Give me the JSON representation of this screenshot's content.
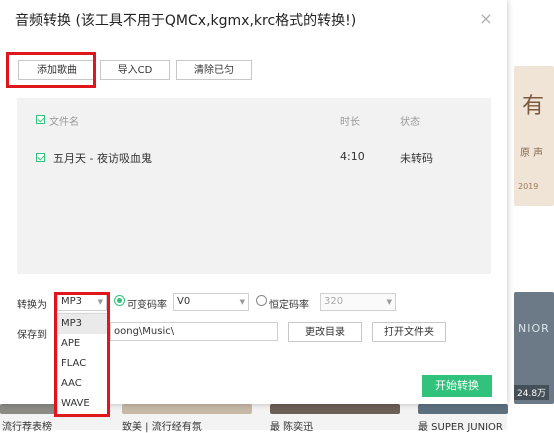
{
  "dialog": {
    "title": "音频转换 (该工具不用于QMCx,kgmx,krc格式的转换!)",
    "close_glyph": "×",
    "buttons": {
      "add_song": "添加歌曲",
      "import_cd": "导入CD",
      "clear_done": "清除已匀"
    },
    "list": {
      "headers": {
        "file_name": "文件名",
        "duration": "时长",
        "status": "状态"
      },
      "rows": [
        {
          "name": "五月天 - 夜访吸血鬼",
          "duration": "4:10",
          "status": "未转码",
          "checked": true
        }
      ]
    },
    "convert": {
      "label": "转换为",
      "format_value": "MP3",
      "format_options": [
        "MP3",
        "APE",
        "FLAC",
        "AAC",
        "WAVE"
      ],
      "vbr_label": "可变码率",
      "vbr_value": "V0",
      "vbr_selected": true,
      "cbr_label": "恒定码率",
      "cbr_value": "320"
    },
    "save": {
      "label": "保存到",
      "path": "oong\\Music\\",
      "change_dir": "更改目录",
      "open_folder": "打开文件夹"
    },
    "start_button": "开始转换"
  },
  "background": {
    "art_top_big": "有",
    "art_top_mid": "原 声",
    "art_top_small": "2019",
    "art_right_text": "NIOR",
    "art_right_plays": "24.8万",
    "bottom_labels": [
      "流行荐表榜",
      "致美 | 流行经有氛",
      "最 陈奕迅",
      "最 SUPER JUNIOR"
    ]
  },
  "colors": {
    "accent": "#31c27c",
    "highlight": "#e0161d"
  }
}
